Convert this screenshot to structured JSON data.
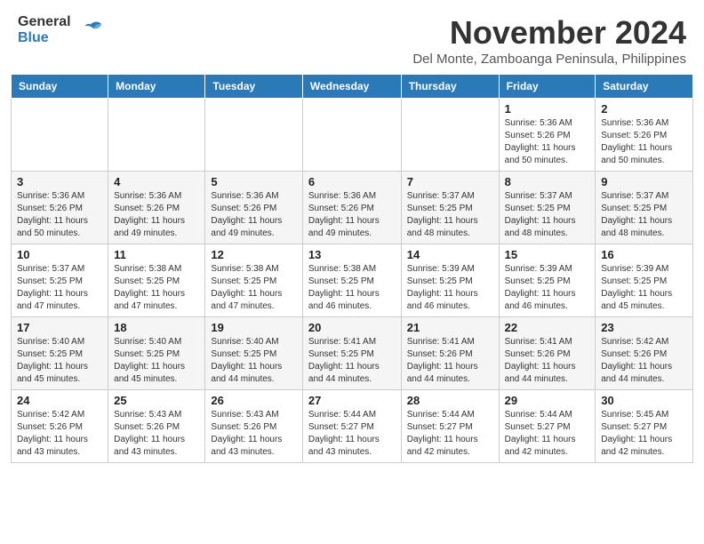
{
  "logo": {
    "general": "General",
    "blue": "Blue"
  },
  "title": "November 2024",
  "subtitle": "Del Monte, Zamboanga Peninsula, Philippines",
  "days_header": [
    "Sunday",
    "Monday",
    "Tuesday",
    "Wednesday",
    "Thursday",
    "Friday",
    "Saturday"
  ],
  "weeks": [
    [
      {
        "day": "",
        "info": ""
      },
      {
        "day": "",
        "info": ""
      },
      {
        "day": "",
        "info": ""
      },
      {
        "day": "",
        "info": ""
      },
      {
        "day": "",
        "info": ""
      },
      {
        "day": "1",
        "info": "Sunrise: 5:36 AM\nSunset: 5:26 PM\nDaylight: 11 hours and 50 minutes."
      },
      {
        "day": "2",
        "info": "Sunrise: 5:36 AM\nSunset: 5:26 PM\nDaylight: 11 hours and 50 minutes."
      }
    ],
    [
      {
        "day": "3",
        "info": "Sunrise: 5:36 AM\nSunset: 5:26 PM\nDaylight: 11 hours and 50 minutes."
      },
      {
        "day": "4",
        "info": "Sunrise: 5:36 AM\nSunset: 5:26 PM\nDaylight: 11 hours and 49 minutes."
      },
      {
        "day": "5",
        "info": "Sunrise: 5:36 AM\nSunset: 5:26 PM\nDaylight: 11 hours and 49 minutes."
      },
      {
        "day": "6",
        "info": "Sunrise: 5:36 AM\nSunset: 5:26 PM\nDaylight: 11 hours and 49 minutes."
      },
      {
        "day": "7",
        "info": "Sunrise: 5:37 AM\nSunset: 5:25 PM\nDaylight: 11 hours and 48 minutes."
      },
      {
        "day": "8",
        "info": "Sunrise: 5:37 AM\nSunset: 5:25 PM\nDaylight: 11 hours and 48 minutes."
      },
      {
        "day": "9",
        "info": "Sunrise: 5:37 AM\nSunset: 5:25 PM\nDaylight: 11 hours and 48 minutes."
      }
    ],
    [
      {
        "day": "10",
        "info": "Sunrise: 5:37 AM\nSunset: 5:25 PM\nDaylight: 11 hours and 47 minutes."
      },
      {
        "day": "11",
        "info": "Sunrise: 5:38 AM\nSunset: 5:25 PM\nDaylight: 11 hours and 47 minutes."
      },
      {
        "day": "12",
        "info": "Sunrise: 5:38 AM\nSunset: 5:25 PM\nDaylight: 11 hours and 47 minutes."
      },
      {
        "day": "13",
        "info": "Sunrise: 5:38 AM\nSunset: 5:25 PM\nDaylight: 11 hours and 46 minutes."
      },
      {
        "day": "14",
        "info": "Sunrise: 5:39 AM\nSunset: 5:25 PM\nDaylight: 11 hours and 46 minutes."
      },
      {
        "day": "15",
        "info": "Sunrise: 5:39 AM\nSunset: 5:25 PM\nDaylight: 11 hours and 46 minutes."
      },
      {
        "day": "16",
        "info": "Sunrise: 5:39 AM\nSunset: 5:25 PM\nDaylight: 11 hours and 45 minutes."
      }
    ],
    [
      {
        "day": "17",
        "info": "Sunrise: 5:40 AM\nSunset: 5:25 PM\nDaylight: 11 hours and 45 minutes."
      },
      {
        "day": "18",
        "info": "Sunrise: 5:40 AM\nSunset: 5:25 PM\nDaylight: 11 hours and 45 minutes."
      },
      {
        "day": "19",
        "info": "Sunrise: 5:40 AM\nSunset: 5:25 PM\nDaylight: 11 hours and 44 minutes."
      },
      {
        "day": "20",
        "info": "Sunrise: 5:41 AM\nSunset: 5:25 PM\nDaylight: 11 hours and 44 minutes."
      },
      {
        "day": "21",
        "info": "Sunrise: 5:41 AM\nSunset: 5:26 PM\nDaylight: 11 hours and 44 minutes."
      },
      {
        "day": "22",
        "info": "Sunrise: 5:41 AM\nSunset: 5:26 PM\nDaylight: 11 hours and 44 minutes."
      },
      {
        "day": "23",
        "info": "Sunrise: 5:42 AM\nSunset: 5:26 PM\nDaylight: 11 hours and 44 minutes."
      }
    ],
    [
      {
        "day": "24",
        "info": "Sunrise: 5:42 AM\nSunset: 5:26 PM\nDaylight: 11 hours and 43 minutes."
      },
      {
        "day": "25",
        "info": "Sunrise: 5:43 AM\nSunset: 5:26 PM\nDaylight: 11 hours and 43 minutes."
      },
      {
        "day": "26",
        "info": "Sunrise: 5:43 AM\nSunset: 5:26 PM\nDaylight: 11 hours and 43 minutes."
      },
      {
        "day": "27",
        "info": "Sunrise: 5:44 AM\nSunset: 5:27 PM\nDaylight: 11 hours and 43 minutes."
      },
      {
        "day": "28",
        "info": "Sunrise: 5:44 AM\nSunset: 5:27 PM\nDaylight: 11 hours and 42 minutes."
      },
      {
        "day": "29",
        "info": "Sunrise: 5:44 AM\nSunset: 5:27 PM\nDaylight: 11 hours and 42 minutes."
      },
      {
        "day": "30",
        "info": "Sunrise: 5:45 AM\nSunset: 5:27 PM\nDaylight: 11 hours and 42 minutes."
      }
    ]
  ]
}
